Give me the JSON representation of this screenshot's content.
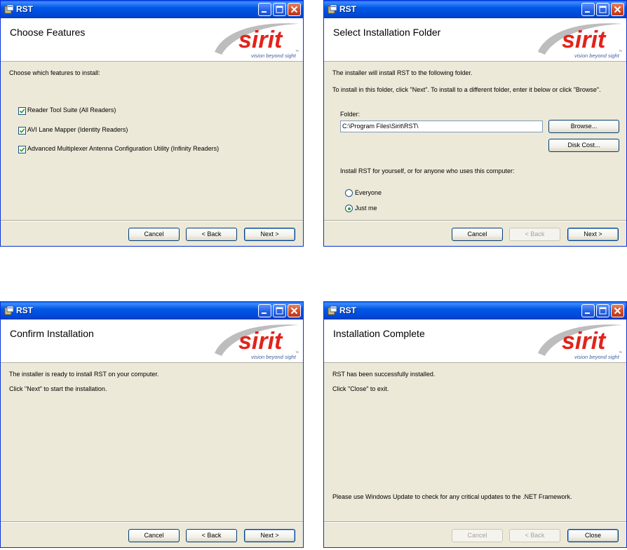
{
  "app_title": "RST",
  "logo": {
    "brand": "sirit",
    "tagline": "vision beyond sight",
    "tm": "™"
  },
  "colors": {
    "titlebar": "#0058E6",
    "dialog_bg": "#ECE9D8",
    "logo_red": "#E2231A",
    "logo_swoosh": "#9a9a9a"
  },
  "choose_features": {
    "heading": "Choose Features",
    "prompt": "Choose which features to install:",
    "features": [
      {
        "label": "Reader Tool Suite (All Readers)",
        "checked": true
      },
      {
        "label": "AVI Lane Mapper (Identity Readers)",
        "checked": true
      },
      {
        "label": "Advanced Multiplexer Antenna Configuration Utility (Infinity Readers)",
        "checked": true
      }
    ],
    "buttons": {
      "cancel": "Cancel",
      "back": "< Back",
      "next": "Next >"
    }
  },
  "select_folder": {
    "heading": "Select Installation Folder",
    "line1": "The installer will install RST to the following folder.",
    "line2": "To install in this folder, click \"Next\". To install to a different folder, enter it below or click \"Browse\".",
    "folder_label": "Folder:",
    "folder_value": "C:\\Program Files\\Sirit\\RST\\",
    "browse": "Browse...",
    "disk_cost": "Disk Cost...",
    "install_for": "Install RST for yourself, or for anyone who uses this computer:",
    "options": [
      {
        "label": "Everyone",
        "selected": false
      },
      {
        "label": "Just me",
        "selected": true
      }
    ],
    "buttons": {
      "cancel": "Cancel",
      "back": "< Back",
      "next": "Next >"
    }
  },
  "confirm": {
    "heading": "Confirm Installation",
    "line1": "The installer is ready to install RST on your computer.",
    "line2": "Click \"Next\" to start the installation.",
    "buttons": {
      "cancel": "Cancel",
      "back": "< Back",
      "next": "Next >"
    }
  },
  "complete": {
    "heading": "Installation Complete",
    "line1": "RST has been successfully installed.",
    "line2": "Click \"Close\" to exit.",
    "note": "Please use Windows Update to check for any critical updates to the .NET Framework.",
    "buttons": {
      "cancel": "Cancel",
      "back": "< Back",
      "close": "Close"
    }
  }
}
